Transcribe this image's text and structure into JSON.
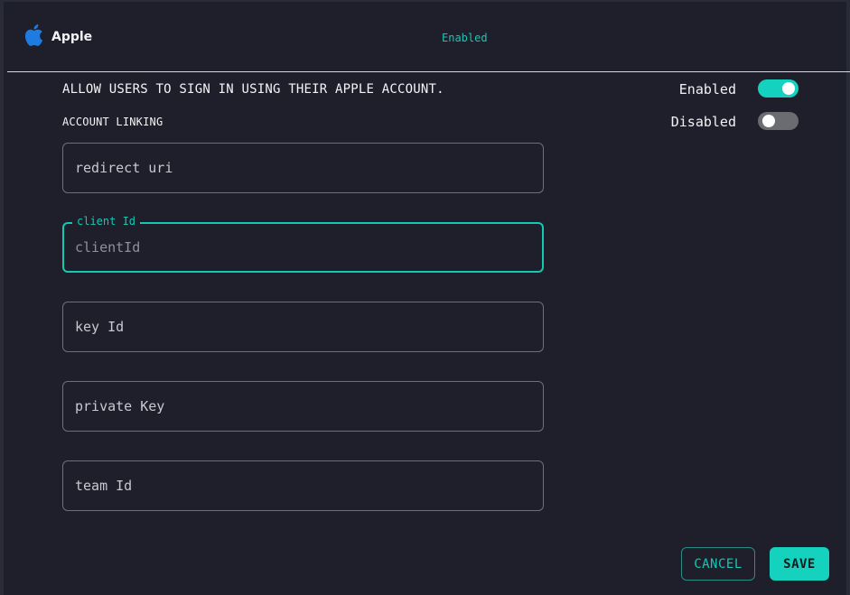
{
  "header": {
    "provider_name": "Apple",
    "status": "Enabled",
    "icon": "apple-logo-icon",
    "icon_color": "#1e7be0"
  },
  "settings": {
    "allow_signin_label": "ALLOW USERS TO SIGN IN USING THEIR APPLE ACCOUNT.",
    "allow_signin_state": "Enabled",
    "allow_signin_on": true,
    "account_linking_label": "ACCOUNT LINKING",
    "account_linking_state": "Disabled",
    "account_linking_on": false
  },
  "fields": {
    "redirect_uri": {
      "placeholder": "redirect uri",
      "value": ""
    },
    "client_id": {
      "label": "client Id",
      "placeholder": "clientId",
      "value": ""
    },
    "key_id": {
      "placeholder": "key Id",
      "value": ""
    },
    "private_key": {
      "placeholder": "private Key",
      "value": ""
    },
    "team_id": {
      "placeholder": "team Id",
      "value": ""
    }
  },
  "actions": {
    "cancel_label": "CANCEL",
    "save_label": "SAVE"
  },
  "colors": {
    "accent": "#14d2be",
    "background": "#1e1f2b",
    "toggle_off": "#6b6b72"
  }
}
